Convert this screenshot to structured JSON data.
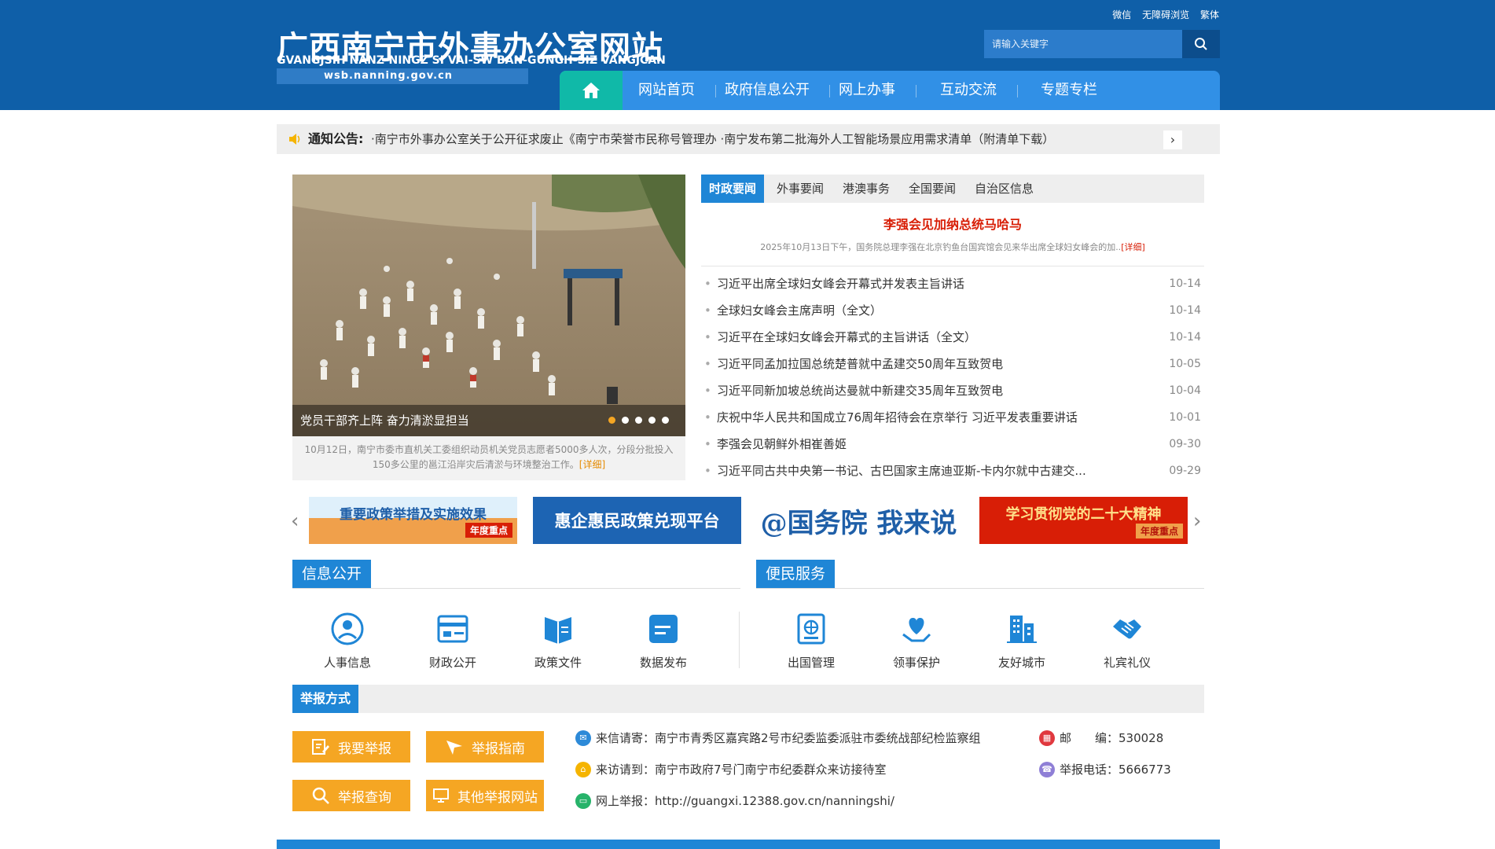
{
  "header": {
    "logo_cn": "广西南宁市外事办公室网站",
    "logo_en": "GVANGJSIH NANZ-NINGZ SI VAI-SW BAN-GUNGH-SIZ VANGJCAN",
    "logo_url": "wsb.nanning.gov.cn",
    "top_links": [
      "微信",
      "无障碍浏览",
      "繁体"
    ],
    "search_placeholder": "请输入关键字"
  },
  "nav": {
    "items": [
      "网站首页",
      "政府信息公开",
      "网上办事",
      "互动交流",
      "专题专栏"
    ]
  },
  "notice": {
    "label": "通知公告:",
    "text": "·南宁市外事办公室关于公开征求废止《南宁市荣誉市民称号管理办  ·南宁发布第二批海外人工智能场景应用需求清单（附清单下载）"
  },
  "slider": {
    "caption": "党员干部齐上阵 奋力清淤显担当",
    "desc": "10月12日，南宁市委市直机关工委组织动员机关党员志愿者5000多人次，分段分批投入150多公里的邕江沿岸灾后清淤与环境整治工作。",
    "more": "[详细]",
    "dots": 5
  },
  "news": {
    "tabs": [
      "时政要闻",
      "外事要闻",
      "港澳事务",
      "全国要闻",
      "自治区信息"
    ],
    "headline": "李强会见加纳总统马哈马",
    "headline_summary": "2025年10月13日下午，国务院总理李强在北京钓鱼台国宾馆会见来华出席全球妇女峰会的加..",
    "headline_more": "[详细]",
    "items": [
      {
        "title": "习近平出席全球妇女峰会开幕式并发表主旨讲话",
        "date": "10-14"
      },
      {
        "title": "全球妇女峰会主席声明（全文）",
        "date": "10-14"
      },
      {
        "title": "习近平在全球妇女峰会开幕式的主旨讲话（全文）",
        "date": "10-14"
      },
      {
        "title": "习近平同孟加拉国总统楚普就中孟建交50周年互致贺电",
        "date": "10-05"
      },
      {
        "title": "习近平同新加坡总统尚达曼就中新建交35周年互致贺电",
        "date": "10-04"
      },
      {
        "title": "庆祝中华人民共和国成立76周年招待会在京举行 习近平发表重要讲话",
        "date": "10-01"
      },
      {
        "title": "李强会见朝鲜外相崔善姬",
        "date": "09-30"
      },
      {
        "title": "习近平同古共中央第一书记、古巴国家主席迪亚斯-卡内尔就中古建交...",
        "date": "09-29"
      }
    ]
  },
  "banners": [
    {
      "text": "重要政策举措及实施效果",
      "tag": "年度重点"
    },
    {
      "text": "惠企惠民政策兑现平台",
      "tag": ""
    },
    {
      "text": "@国务院 我来说",
      "tag": ""
    },
    {
      "text": "学习贯彻党的二十大精神",
      "tag": "年度重点"
    }
  ],
  "info_public": {
    "title": "信息公开",
    "items": [
      "人事信息",
      "财政公开",
      "政策文件",
      "数据发布"
    ]
  },
  "services": {
    "title": "便民服务",
    "items": [
      "出国管理",
      "领事保护",
      "友好城市",
      "礼宾礼仪"
    ]
  },
  "report": {
    "title": "举报方式",
    "buttons": [
      "我要举报",
      "举报指南",
      "举报查询",
      "其他举报网站"
    ],
    "letter": "来信请寄：南宁市青秀区嘉宾路2号市纪委监委派驻市委统战部纪检监察组",
    "visit": "来访请到：南宁市政府7号门南宁市纪委群众来访接待室",
    "online": "网上举报：http://guangxi.12388.gov.cn/nanningshi/",
    "postcode": "邮　　编：530028",
    "phone": "举报电话：5666773"
  },
  "colors": {
    "header_bg": "#0f5fa8",
    "nav_bg": "#3190e6",
    "accent": "#1f86d6",
    "headline_red": "#d81e06",
    "button_orange": "#f5a623"
  }
}
